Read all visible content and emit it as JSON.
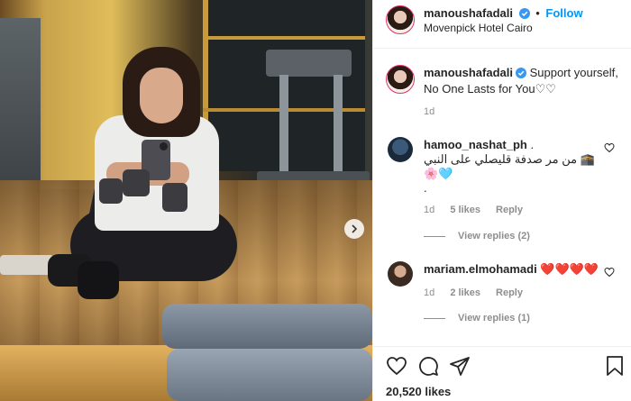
{
  "post": {
    "username": "manoushafadali",
    "follow_label": "Follow",
    "separator": "•",
    "location": "Movenpick Hotel Cairo"
  },
  "caption": {
    "username": "manoushafadali",
    "text": "Support yourself, No One Lasts for You♡♡",
    "time": "1d"
  },
  "comments": [
    {
      "username": "hamoo_nashat_ph",
      "text_line1": ".",
      "text_line2": "من مر صدفة قليصلي على النبي 🕋",
      "text_line3": "🌸🩵",
      "text_line4": ".",
      "time": "1d",
      "likes": "5 likes",
      "reply": "Reply",
      "view_replies": "View replies (2)"
    },
    {
      "username": "mariam.elmohamadi",
      "text_line1": "❤️❤️❤️❤️",
      "time": "1d",
      "likes": "2 likes",
      "reply": "Reply",
      "view_replies": "View replies (1)"
    }
  ],
  "footer": {
    "likes": "20,520 likes"
  },
  "icons": {
    "verified": "verified-badge-icon",
    "like": "heart-icon",
    "comment": "comment-icon",
    "share": "share-icon",
    "save": "bookmark-icon",
    "next": "chevron-right-icon"
  },
  "colors": {
    "accent": "#0095f6",
    "text": "#262626",
    "muted": "#8e8e8e",
    "heart": "#ed4956"
  }
}
